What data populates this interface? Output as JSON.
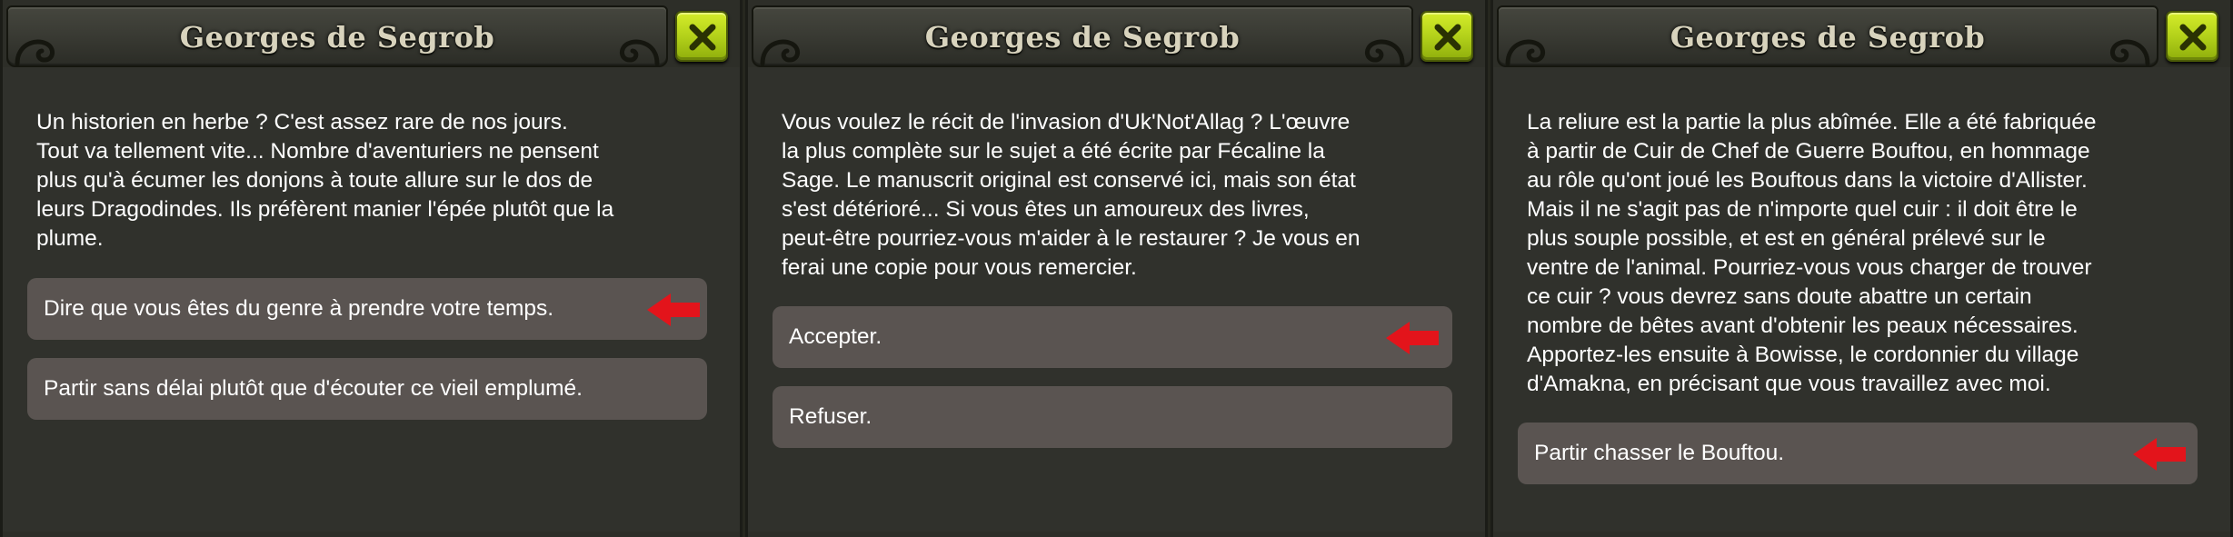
{
  "colors": {
    "background": "#2d2e28",
    "option_background": "#5a5451",
    "close_button": "#b3d11a",
    "arrow": "#e3141b",
    "title_text": "#d8d3bd"
  },
  "panels": [
    {
      "title": "Georges de Segrob",
      "close_icon": "close-x-icon",
      "text": "Un historien en herbe ? C'est assez rare de nos jours.\nTout va tellement vite... Nombre d'aventuriers ne pensent\nplus qu'à écumer les donjons à toute allure sur le dos de\nleurs Dragodindes. Ils préfèrent manier l'épée plutôt que la\nplume.",
      "options": [
        {
          "label": "Dire que vous êtes du genre à prendre votre temps.",
          "highlighted": true
        },
        {
          "label": "Partir sans délai plutôt que d'écouter ce vieil emplumé.",
          "highlighted": false
        }
      ]
    },
    {
      "title": "Georges de Segrob",
      "close_icon": "close-x-icon",
      "text": "Vous voulez le récit de l'invasion d'Uk'Not'Allag ? L'œuvre\nla plus complète sur le sujet a été écrite par Fécaline la\nSage. Le manuscrit original est conservé ici, mais son état\ns'est détérioré... Si vous êtes un amoureux des livres,\npeut-être pourriez-vous m'aider à le restaurer ? Je vous en\nferai une copie pour vous remercier.",
      "options": [
        {
          "label": "Accepter.",
          "highlighted": true
        },
        {
          "label": "Refuser.",
          "highlighted": false
        }
      ]
    },
    {
      "title": "Georges de Segrob",
      "close_icon": "close-x-icon",
      "text": "La reliure est la partie la plus abîmée. Elle a été fabriquée\nà partir de Cuir de Chef de Guerre Bouftou, en hommage\nau rôle qu'ont joué les Bouftous dans la victoire d'Allister.\nMais il ne s'agit pas de n'importe quel cuir : il doit être le\nplus souple possible, et est en général prélevé sur le\nventre de l'animal. Pourriez-vous vous charger de trouver\nce cuir ? vous devrez sans doute abattre un certain\nnombre de bêtes avant d'obtenir les peaux nécessaires.\nApportez-les ensuite à Bowisse, le cordonnier du village\nd'Amakna, en précisant que vous travaillez avec moi.",
      "options": [
        {
          "label": "Partir chasser le Bouftou.",
          "highlighted": true
        }
      ]
    }
  ]
}
